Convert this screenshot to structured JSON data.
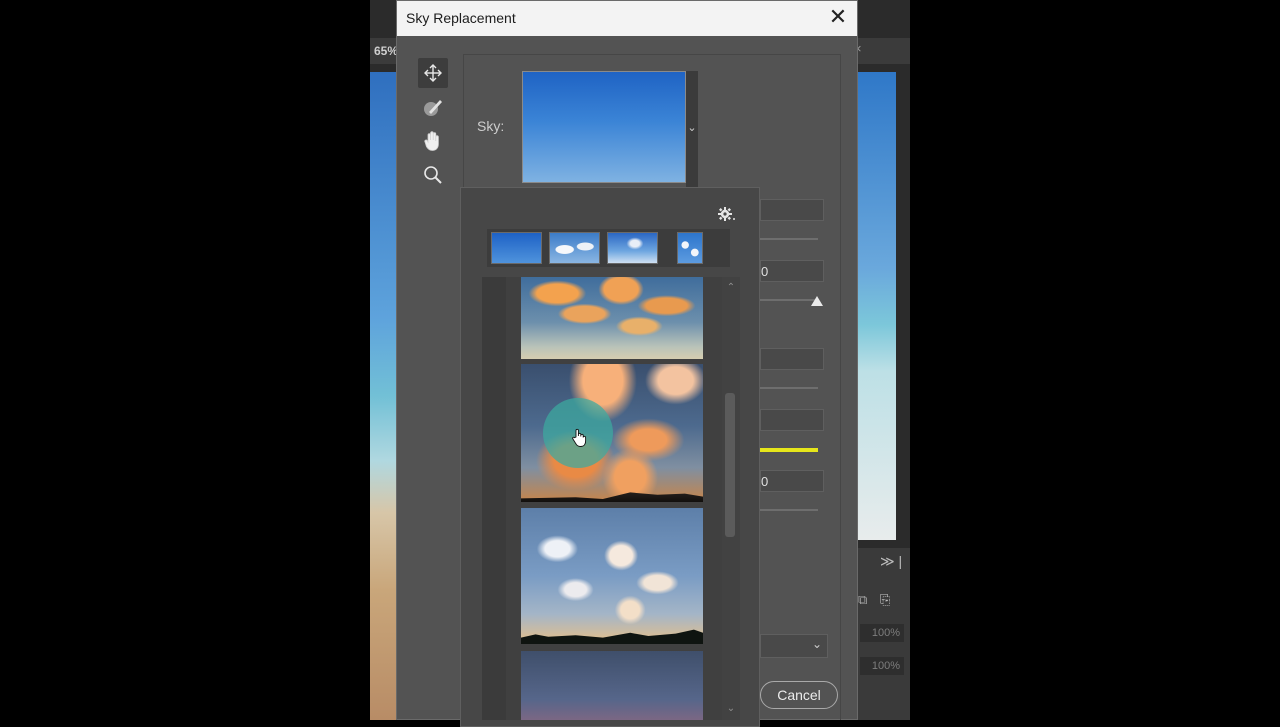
{
  "workspace": {
    "zoom_label": "65%",
    "doc_close": "×",
    "panel_expand": "≫ |",
    "percent_fields": [
      "100%",
      "100%"
    ]
  },
  "dialog": {
    "title": "Sky Replacement",
    "close_label": "✕",
    "tools": [
      {
        "name": "move-tool",
        "icon": "move-icon"
      },
      {
        "name": "sky-brush-tool",
        "icon": "sky-brush-icon"
      },
      {
        "name": "hand-tool",
        "icon": "hand-icon"
      },
      {
        "name": "zoom-tool",
        "icon": "magnifier-icon"
      }
    ],
    "sky_label": "Sky:",
    "sliders_visible_values": [
      "0",
      "0"
    ],
    "cancel_label": "Cancel",
    "accent_color": "#e6e61a"
  },
  "sky_picker": {
    "settings_icon": "gear-icon",
    "recent_skies": [
      "blue-gradient",
      "blue-with-clouds",
      "blue-spectacular",
      "blue-puffy-clouds"
    ],
    "sky_list": [
      "orange-scattered-clouds",
      "sunset-dramatic-clouds",
      "evening-scattered-clouds",
      "dusk-purple"
    ],
    "selected_index": 1
  }
}
